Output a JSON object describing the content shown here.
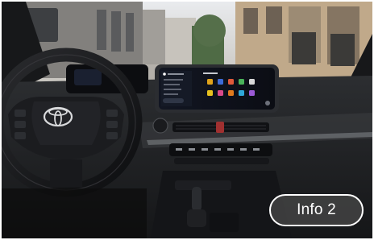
{
  "overlay": {
    "info_button_label": "Info 2"
  },
  "scene": {
    "brand_logo": "toyota-logo",
    "colors": {
      "dashboard": "#1f2124",
      "screen": "#0d0f14",
      "street": "#b7b3ad"
    }
  }
}
